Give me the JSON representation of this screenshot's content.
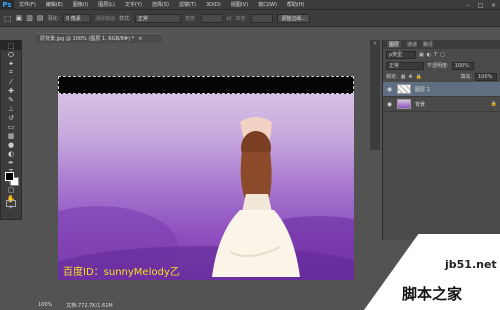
{
  "app": {
    "logo": "Ps"
  },
  "menu": [
    "文件(F)",
    "编辑(E)",
    "图像(I)",
    "图层(L)",
    "文字(Y)",
    "选择(S)",
    "滤镜(T)",
    "3D(D)",
    "视图(V)",
    "窗口(W)",
    "帮助(H)"
  ],
  "window_controls": {
    "minimize": "–",
    "maximize": "□",
    "close": "×"
  },
  "options_bar": {
    "feather_label": "羽化:",
    "feather_value": "0 像素",
    "antialias_label": "消除锯齿",
    "style_label": "样式:",
    "style_value": "正常",
    "width_label": "宽度:",
    "height_label": "高度:",
    "refine_edge_button": "调整边缘..."
  },
  "document": {
    "tab_label": "原背景.jpg @ 100% (图层 1, RGB/8#) *",
    "close": "×"
  },
  "canvas": {
    "watermark": "百度ID：sunnyMelody乙"
  },
  "status": {
    "zoom": "100%",
    "doc_info": "文档:772.7K/1.61M"
  },
  "site_mark": {
    "url": "jb51.net",
    "name": "脚本之家"
  },
  "layers_panel": {
    "tabs": [
      "图层",
      "通道",
      "路径"
    ],
    "filter_label": "ρ类型",
    "blend_mode": "正常",
    "opacity_label": "不透明度:",
    "opacity_value": "100%",
    "lock_label": "锁定:",
    "fill_label": "填充:",
    "fill_value": "100%",
    "layers": [
      {
        "name": "图层 1",
        "selected": true
      },
      {
        "name": "背景",
        "selected": false
      }
    ]
  },
  "colors": {
    "accent": "#31a8ff",
    "watermark": "#f5e21b",
    "ui_bg": "#535353"
  }
}
